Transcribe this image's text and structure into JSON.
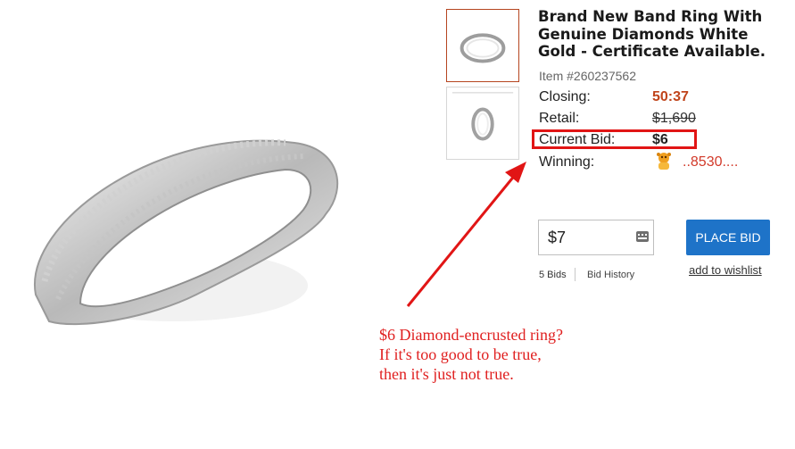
{
  "listing": {
    "title": "Brand New Band Ring With\nGenuine Diamonds White\nGold - Certificate Available.",
    "item_number": "Item #260237562"
  },
  "details": {
    "closing_label": "Closing:",
    "closing_value": "50:37",
    "retail_label": "Retail:",
    "retail_value": "$1,690",
    "current_bid_label": "Current Bid:",
    "current_bid_value": "$6",
    "winning_label": "Winning:",
    "winning_user": "..8530...."
  },
  "bid_form": {
    "input_value": "$7",
    "place_bid_label": "PLACE BID",
    "bids_count": "5 Bids",
    "bid_history_label": "Bid History",
    "wishlist_label": "add to wishlist"
  },
  "annotation": {
    "line1": "$6 Diamond-encrusted ring?",
    "line2": "If it's too good to be true,",
    "line3": "then it's just not true."
  },
  "icons": {
    "keypad": "keypad-icon",
    "avatar": "winner-avatar-icon"
  },
  "colors": {
    "closing": "#c0441b",
    "annotation": "#e02020",
    "button": "#1e73c8"
  }
}
